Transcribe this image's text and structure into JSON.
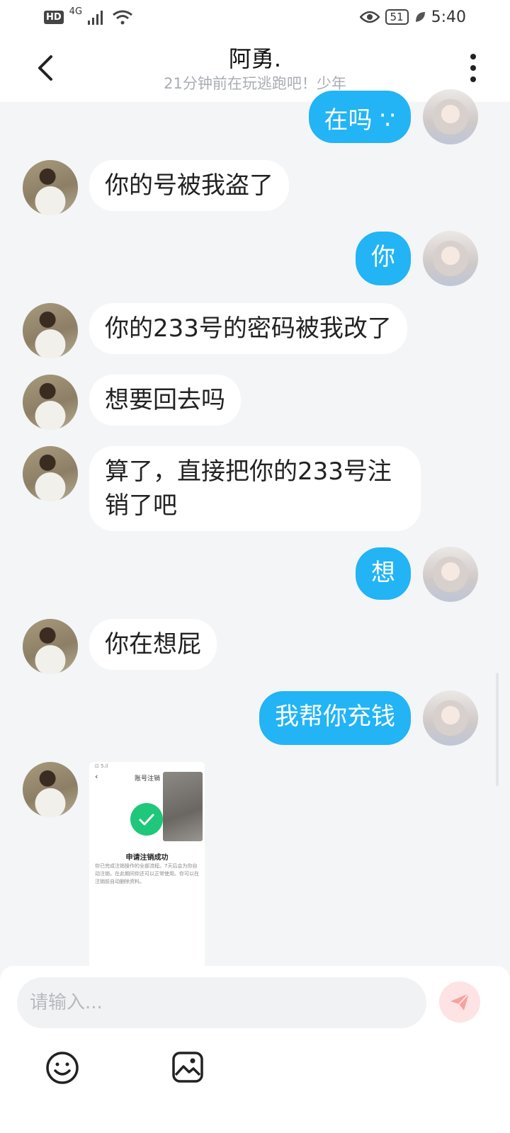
{
  "status_bar": {
    "hd": "HD",
    "network": "4G",
    "battery": "51",
    "time": "5:40"
  },
  "header": {
    "title": "阿勇.",
    "subtitle": "21分钟前在玩逃跑吧！少年"
  },
  "messages": [
    {
      "from": "me",
      "text": "在吗 ∵"
    },
    {
      "from": "friend",
      "text": "你的号被我盗了"
    },
    {
      "from": "me",
      "text": "你"
    },
    {
      "from": "friend",
      "text": "你的233号的密码被我改了"
    },
    {
      "from": "friend",
      "text": "想要回去吗"
    },
    {
      "from": "friend",
      "text": "算了，直接把你的233号注销了吧"
    },
    {
      "from": "me",
      "text": "想"
    },
    {
      "from": "friend",
      "text": "你在想屁"
    },
    {
      "from": "me",
      "text": "我帮你充钱"
    },
    {
      "from": "friend",
      "type": "image"
    }
  ],
  "image_message": {
    "status": "⊡ 5.il",
    "title": "账号注销",
    "back": "‹",
    "heading": "申请注销成功",
    "text": "你已完成注销操作的全部流程。7天后会为你自动注销，在此期间你还可以正常使用。你可以在注销前自动删除资料。"
  },
  "input": {
    "placeholder": "请输入..."
  },
  "colors": {
    "outgoing_bubble": "#22b4f5",
    "incoming_bubble": "#ffffff",
    "background": "#f4f5f7",
    "send_button": "#fde3e3",
    "send_icon": "#f7a1a1"
  }
}
